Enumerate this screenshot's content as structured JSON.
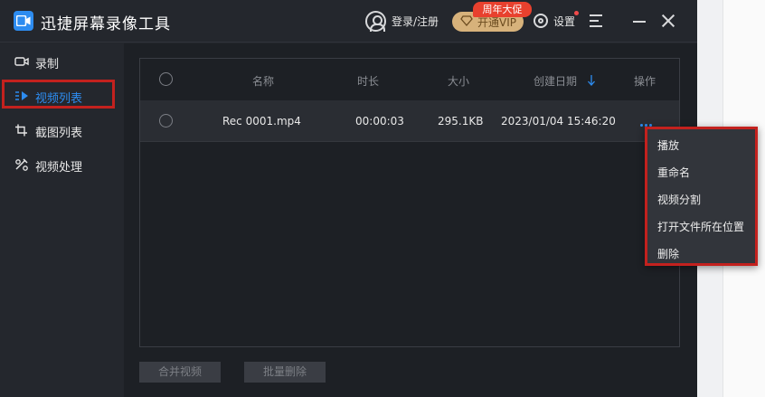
{
  "window": {
    "title": "迅捷屏幕录像工具",
    "login_label": "登录/注册",
    "vip_label": "开通VIP",
    "promo_badge": "周年大促",
    "settings_label": "设置"
  },
  "sidebar": {
    "items": [
      {
        "label": "录制",
        "icon": "record-icon"
      },
      {
        "label": "视频列表",
        "icon": "video-list-icon",
        "active": true
      },
      {
        "label": "截图列表",
        "icon": "screenshot-list-icon"
      },
      {
        "label": "视频处理",
        "icon": "video-tools-icon"
      }
    ]
  },
  "table": {
    "columns": [
      "名称",
      "时长",
      "大小",
      "创建日期",
      "操作"
    ],
    "sort_column": "创建日期",
    "sort_direction": "descending",
    "rows": [
      {
        "name": "Rec 0001.mp4",
        "duration": "00:00:03",
        "size": "295.1KB",
        "created": "2023/01/04 15:46:20"
      }
    ]
  },
  "footer": {
    "merge_button": "合并视频",
    "batch_delete_button": "批量删除"
  },
  "context_menu": {
    "items": [
      "播放",
      "重命名",
      "视频分割",
      "打开文件所在位置",
      "删除"
    ]
  },
  "colors": {
    "accent": "#2d8cf0",
    "highlight_outline": "#c3211e",
    "promo_red": "#e8412e",
    "vip_gold": "#d7b27b"
  }
}
